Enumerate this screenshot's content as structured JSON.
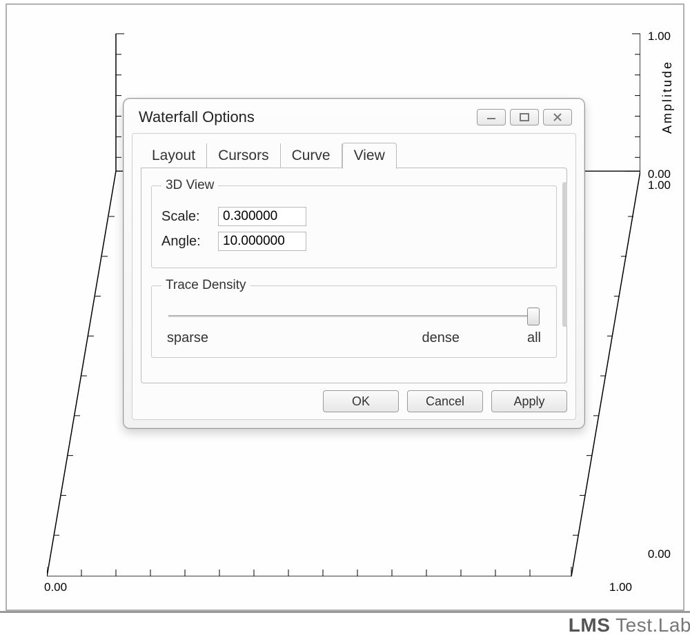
{
  "chart": {
    "amplitude_label": "Amplitude",
    "right_axis_top": "1.00",
    "right_axis_zero": "0.00",
    "right_axis_one_below": "1.00",
    "right_axis_bottom": "0.00",
    "x_axis_left": "0.00",
    "x_axis_right": "1.00"
  },
  "dialog": {
    "title": "Waterfall Options",
    "tabs": [
      "Layout",
      "Cursors",
      "Curve",
      "View"
    ],
    "active_tab": "View",
    "view": {
      "group_3d_title": "3D View",
      "scale_label": "Scale:",
      "scale_value": "0.300000",
      "angle_label": "Angle:",
      "angle_value": "10.000000",
      "trace_density_title": "Trace Density",
      "slider_sparse": "sparse",
      "slider_dense": "dense",
      "slider_all": "all"
    },
    "buttons": {
      "ok": "OK",
      "cancel": "Cancel",
      "apply": "Apply"
    }
  },
  "footer": {
    "brand_bold": "LMS",
    "brand_rest": " Test.Lab"
  }
}
